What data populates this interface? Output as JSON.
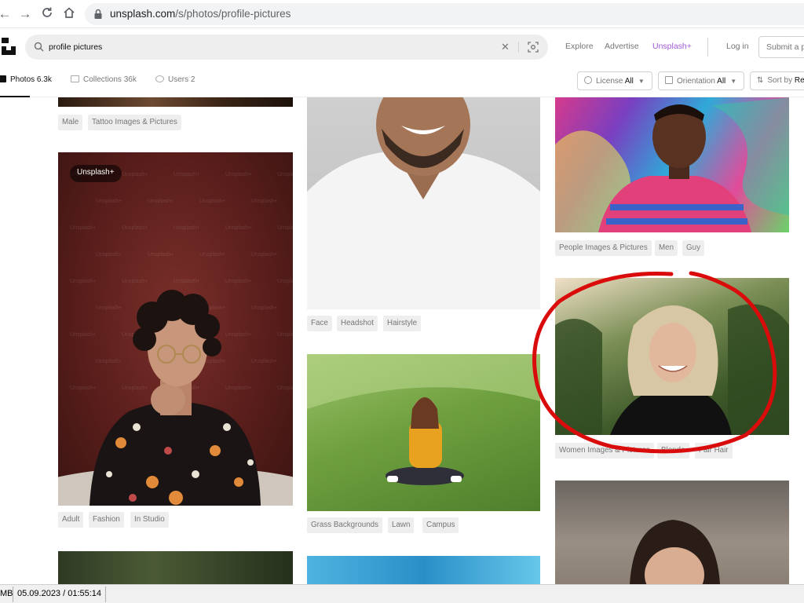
{
  "browser": {
    "url_host": "unsplash.com",
    "url_path": "/s/photos/profile-pictures"
  },
  "header": {
    "search_value": "profile pictures",
    "links": [
      "Explore",
      "Advertise",
      "Unsplash+"
    ],
    "login": "Log in",
    "submit": "Submit a ph"
  },
  "tabs": [
    {
      "label": "Photos",
      "count": "6.3k"
    },
    {
      "label": "Collections",
      "count": "36k"
    },
    {
      "label": "Users",
      "count": "2"
    }
  ],
  "filters": [
    {
      "label": "License",
      "value": "All"
    },
    {
      "label": "Orientation",
      "value": "All"
    },
    {
      "label": "Sort by",
      "value": "Re"
    }
  ],
  "photos": [
    {
      "tags": [
        "Male",
        "Tattoo Images & Pictures"
      ]
    },
    {
      "badge": "Unsplash+",
      "watermark": "Unsplash+",
      "tags": [
        "Adult",
        "Fashion",
        "In Studio"
      ]
    },
    {
      "tags": [
        "Face",
        "Headshot",
        "Hairstyle"
      ]
    },
    {
      "tags": [
        "Grass Backgrounds",
        "Lawn",
        "Campus"
      ]
    },
    {
      "tags": [
        "People Images & Pictures",
        "Men",
        "Guy"
      ]
    },
    {
      "tags": [
        "Women Images & Pictures",
        "Blonde",
        "Fair Hair"
      ]
    }
  ],
  "status": {
    "left": "MB",
    "datetime": "05.09.2023 / 01:55:14"
  },
  "colors": {
    "annotation": "#d90b0b",
    "plus_accent": "#a259d9"
  }
}
